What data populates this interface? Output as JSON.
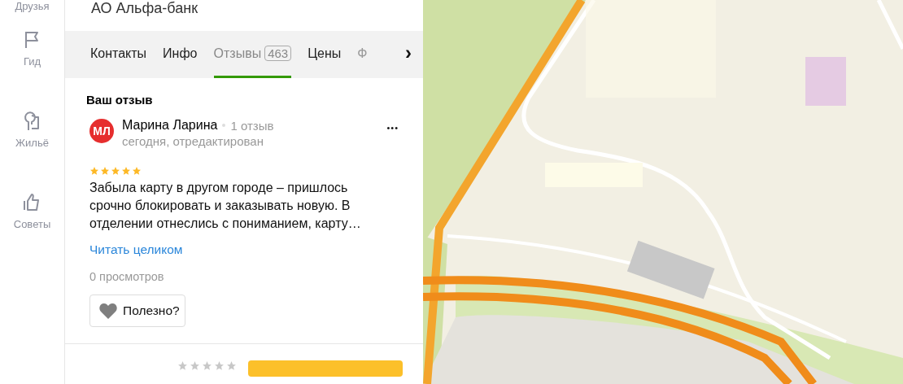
{
  "nav": {
    "items": [
      {
        "label": "Друзья"
      },
      {
        "label": "Гид"
      },
      {
        "label": "Жильё"
      },
      {
        "label": "Советы"
      }
    ]
  },
  "org": {
    "title": "АО Альфа-банк"
  },
  "tabs": [
    {
      "label": "Контакты",
      "selected": false,
      "faded": false
    },
    {
      "label": "Инфо",
      "selected": false,
      "faded": false
    },
    {
      "label": "Отзывы",
      "count": "463",
      "selected": true,
      "faded": false
    },
    {
      "label": "Цены",
      "selected": false,
      "faded": false
    },
    {
      "label": "Ф",
      "selected": false,
      "faded": true
    }
  ],
  "tabs_next": "›",
  "section_title": "Ваш отзыв",
  "review": {
    "avatar": "МЛ",
    "author": "Марина Ларина",
    "author_reviews": "1 отзыв",
    "date": "сегодня, отредактирован",
    "stars": 5,
    "text": "Забыла карту в другом городе – пришлось срочно блокировать и заказывать новую. В отделении отнеслись с пониманием, карту…",
    "read_more": "Читать целиком",
    "views": "0 просмотров",
    "useful": "Полезно?",
    "more": "•••"
  },
  "rate": {
    "stars": 0
  }
}
